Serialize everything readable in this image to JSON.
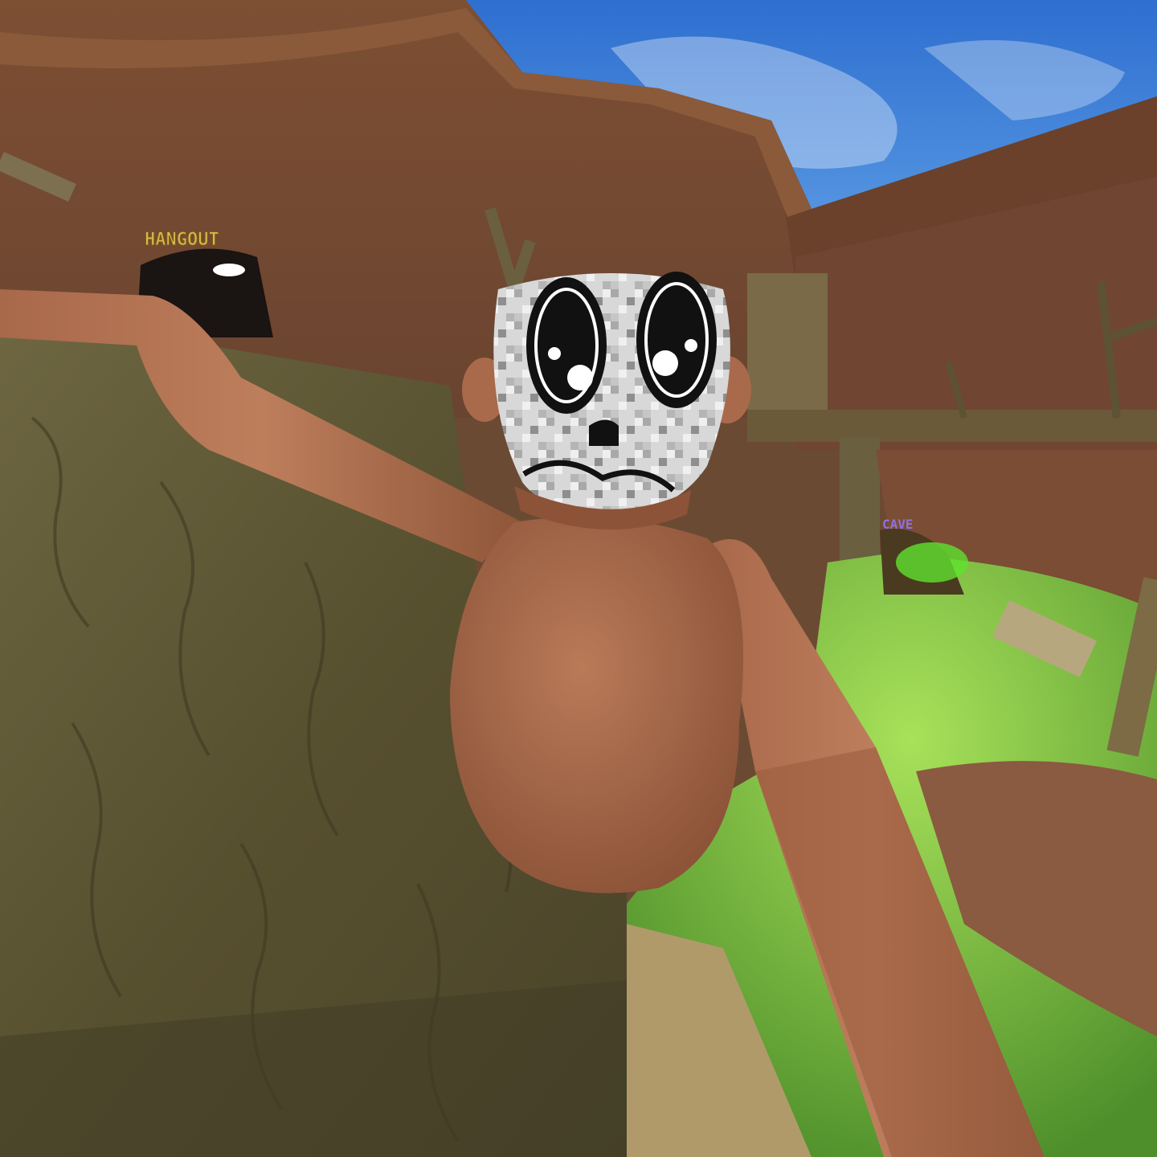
{
  "scene": {
    "signs": {
      "hangout": "HANGOUT",
      "cave": "CAVE"
    },
    "colors": {
      "sky": "#3d7fd6",
      "cliff": "#7a5035",
      "cliff_dark": "#5e3b26",
      "bark": "#5f5636",
      "grass": "#6fb23a",
      "fur": "#a8684a",
      "fur_dark": "#8a5238",
      "sign_yellow": "#d9b84a",
      "sign_purple": "#8c72e0",
      "face_camo": "#cfcfcf"
    },
    "icons": [
      "hangout-sign",
      "cave-sign",
      "monkey-avatar-face"
    ]
  }
}
